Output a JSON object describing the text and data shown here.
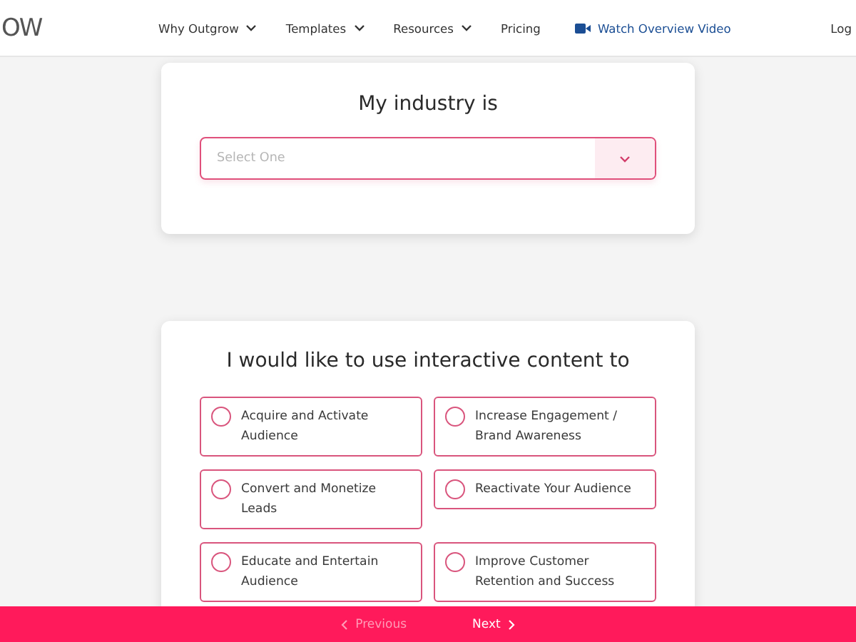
{
  "header": {
    "logo": "OW",
    "nav": [
      {
        "label": "Why Outgrow",
        "kind": "menu"
      },
      {
        "label": "Templates",
        "kind": "menu"
      },
      {
        "label": "Resources",
        "kind": "menu"
      },
      {
        "label": "Pricing",
        "kind": "link"
      },
      {
        "label": "Watch Overview Video",
        "kind": "video"
      }
    ],
    "login": "Log"
  },
  "industry": {
    "title": "My industry is",
    "placeholder": "Select One"
  },
  "goals": {
    "title": "I would like to use interactive content to",
    "options": [
      {
        "label": "Acquire and Activate Audience",
        "selected": false
      },
      {
        "label": "Increase Engagement / Brand Awareness",
        "selected": false
      },
      {
        "label": "Convert and Monetize Leads",
        "selected": false
      },
      {
        "label": "Reactivate Your Audience",
        "selected": false
      },
      {
        "label": "Educate and Entertain Audience",
        "selected": false
      },
      {
        "label": "Improve Customer Retention and Success",
        "selected": false
      }
    ]
  },
  "footer": {
    "previous": {
      "label": "Previous",
      "disabled": true
    },
    "next": {
      "label": "Next",
      "disabled": false
    }
  }
}
